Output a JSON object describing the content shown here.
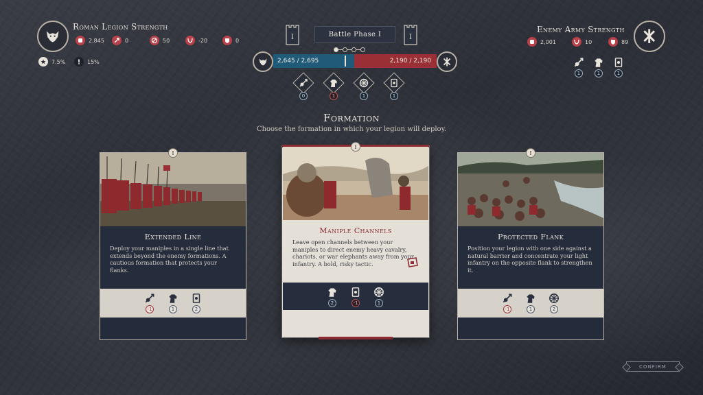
{
  "player": {
    "title": "Roman Legion Strength",
    "emblem_icon": "wolf-icon",
    "stats": [
      {
        "icon": "fist-icon",
        "value": "2,845"
      },
      {
        "icon": "arrow-icon",
        "value": "0"
      },
      {
        "icon": "no-entry-icon",
        "value": "50"
      },
      {
        "icon": "horns-icon",
        "value": "-20"
      },
      {
        "icon": "shield-icon",
        "value": "0"
      }
    ],
    "sub_stats": [
      {
        "icon": "star-icon",
        "value": "7.5%"
      },
      {
        "icon": "exclamation-icon",
        "value": "15%"
      }
    ]
  },
  "phase": {
    "label": "Battle Phase I",
    "tower_left": "I",
    "tower_right": "I",
    "dots": 4,
    "active_dot": 0
  },
  "strength_bar": {
    "player_value": "2,645 / 2,695",
    "enemy_value": "2,190 / 2,190",
    "player_color": "#1f5a78",
    "enemy_color": "#9a2f35"
  },
  "tactic_slots": [
    {
      "icon": "spear-fist-icon",
      "count": "0",
      "negative": false
    },
    {
      "icon": "horse-icon",
      "count": "1",
      "negative": true
    },
    {
      "icon": "wheel-icon",
      "count": "1",
      "negative": false
    },
    {
      "icon": "card-icon",
      "count": "1",
      "negative": false
    }
  ],
  "enemy": {
    "title": "Enemy Army Strength",
    "emblem_icon": "crossed-emblem-icon",
    "stats": [
      {
        "icon": "fist-icon",
        "value": "2,001"
      },
      {
        "icon": "horns-icon",
        "value": "10"
      },
      {
        "icon": "shield-icon",
        "value": "89"
      }
    ],
    "slots": [
      {
        "icon": "spear-fist-icon",
        "count": "1"
      },
      {
        "icon": "horse-icon",
        "count": "1"
      },
      {
        "icon": "card-icon",
        "count": "1"
      }
    ]
  },
  "formation": {
    "title": "Formation",
    "subtitle": "Choose the formation in which your legion will deploy."
  },
  "cards": [
    {
      "number": "I",
      "title": "Extended Line",
      "description": "Deploy your maniples in a single line that extends beyond the enemy formations. A cautious formation that protects your flanks.",
      "selected": false,
      "mods": [
        {
          "icon": "spear-fist-icon",
          "count": "-1",
          "negative": true
        },
        {
          "icon": "horse-icon",
          "count": "1",
          "negative": false
        },
        {
          "icon": "card-icon",
          "count": "2",
          "negative": false
        }
      ]
    },
    {
      "number": "I",
      "title": "Maniple Channels",
      "description": "Leave open channels between your maniples to direct enemy heavy cavalry, chariots, or war elephants away from your infantry. A bold, risky tactic.",
      "selected": true,
      "mods": [
        {
          "icon": "horse-icon",
          "count": "2",
          "negative": false
        },
        {
          "icon": "card-icon",
          "count": "-1",
          "negative": true
        },
        {
          "icon": "wheel-icon",
          "count": "1",
          "negative": false
        }
      ]
    },
    {
      "number": "I",
      "title": "Protected Flank",
      "description": "Position your legion with one side against a natural barrier and concentrate your light infantry on the opposite flank to strengthen it.",
      "selected": false,
      "mods": [
        {
          "icon": "spear-fist-icon",
          "count": "-1",
          "negative": true
        },
        {
          "icon": "horse-icon",
          "count": "1",
          "negative": false
        },
        {
          "icon": "wheel-icon",
          "count": "2",
          "negative": false
        }
      ]
    }
  ],
  "confirm_label": "CONFIRM"
}
